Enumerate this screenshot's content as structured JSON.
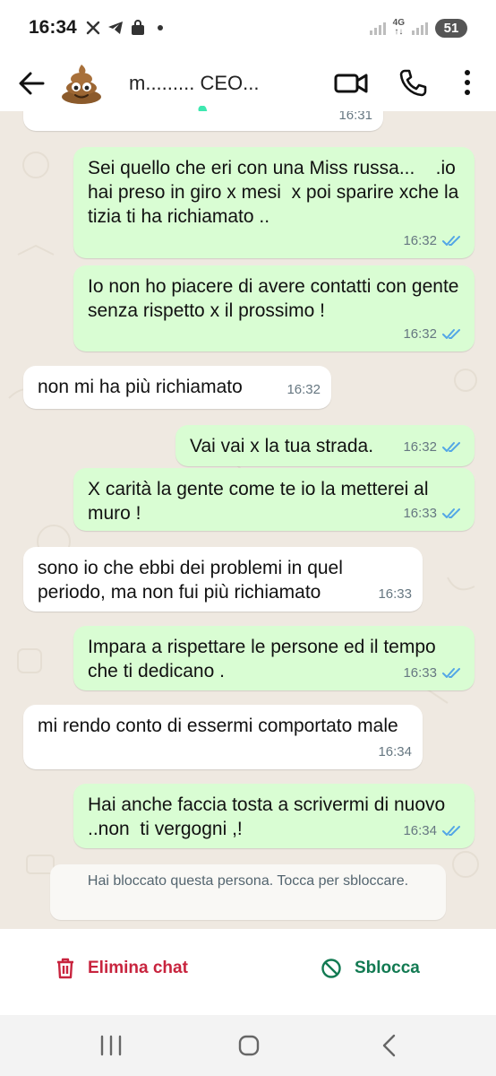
{
  "status_bar": {
    "time": "16:34",
    "network": "4G",
    "battery": "51"
  },
  "header": {
    "contact_name": "m......... CEO...",
    "avatar_icon": "poop-emoji-icon"
  },
  "messages": [
    {
      "direction": "in",
      "text": "",
      "time": "16:31"
    },
    {
      "direction": "out",
      "text": "Sei quello che eri con una Miss russa...    .io hai preso in giro x mesi  x poi sparire xche la tizia ti ha richiamato ..",
      "time": "16:32",
      "read": true
    },
    {
      "direction": "out",
      "text": "Io non ho piacere di avere contatti con gente senza rispetto x il prossimo !",
      "time": "16:32",
      "read": true
    },
    {
      "direction": "in",
      "text": "non mi ha più richiamato",
      "time": "16:32"
    },
    {
      "direction": "out",
      "text": "Vai vai x la tua strada.",
      "time": "16:32",
      "read": true
    },
    {
      "direction": "out",
      "text": "X carità la gente come te io la metterei al muro !",
      "time": "16:33",
      "read": true
    },
    {
      "direction": "in",
      "text": "sono io che ebbi dei problemi in quel periodo, ma non fui più richiamato",
      "time": "16:33"
    },
    {
      "direction": "out",
      "text": "Impara a rispettare le persone ed il tempo  che ti dedicano .",
      "time": "16:33",
      "read": true
    },
    {
      "direction": "in",
      "text": "mi rendo conto di essermi comportato male",
      "time": "16:34"
    },
    {
      "direction": "out",
      "text": "Hai anche faccia tosta a scrivermi di nuovo ..non  ti vergogni ,!",
      "time": "16:34",
      "read": true
    }
  ],
  "blocked_notice": "Hai bloccato questa persona. Tocca per sbloccare.",
  "actions": {
    "delete_label": "Elimina chat",
    "unblock_label": "Sblocca"
  },
  "colors": {
    "outgoing_bubble": "#d9fdd3",
    "incoming_bubble": "#ffffff",
    "chat_background": "#efe9e1",
    "delete_red": "#c8243e",
    "unblock_green": "#127a52",
    "read_ticks": "#53a6e6",
    "scribble": "#3ee8b0"
  }
}
